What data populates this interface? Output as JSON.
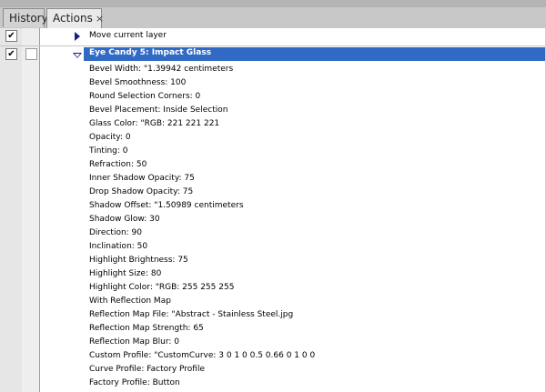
{
  "tabs": [
    {
      "label": "History"
    },
    {
      "label": "Actions",
      "close": "×"
    }
  ],
  "actions": {
    "move_layer": "Move current layer",
    "selected": "Eye Candy 5: Impact Glass",
    "params": [
      "Bevel Width:  \"1.39942 centimeters",
      "Bevel Smoothness: 100",
      "Round Selection Corners: 0",
      "Bevel Placement: Inside Selection",
      "Glass Color:  \"RGB: 221 221 221",
      "Opacity: 0",
      "Tinting: 0",
      "Refraction: 50",
      "Inner Shadow Opacity: 75",
      "Drop Shadow Opacity: 75",
      "Shadow Offset:  \"1.50989 centimeters",
      "Shadow Glow: 30",
      "Direction: 90",
      "Inclination: 50",
      "Highlight Brightness: 75",
      "Highlight Size: 80",
      "Highlight Color:  \"RGB: 255 255 255",
      "With Reflection Map",
      "Reflection Map File:  \"Abstract - Stainless Steel.jpg",
      "Reflection Map Strength: 65",
      "Reflection Map Blur: 0",
      "Custom Profile:  \"CustomCurve: 3 0 1 0 0.5 0.66 0 1 0 0",
      "Curve Profile: Factory Profile",
      "Factory Profile: Button"
    ]
  }
}
